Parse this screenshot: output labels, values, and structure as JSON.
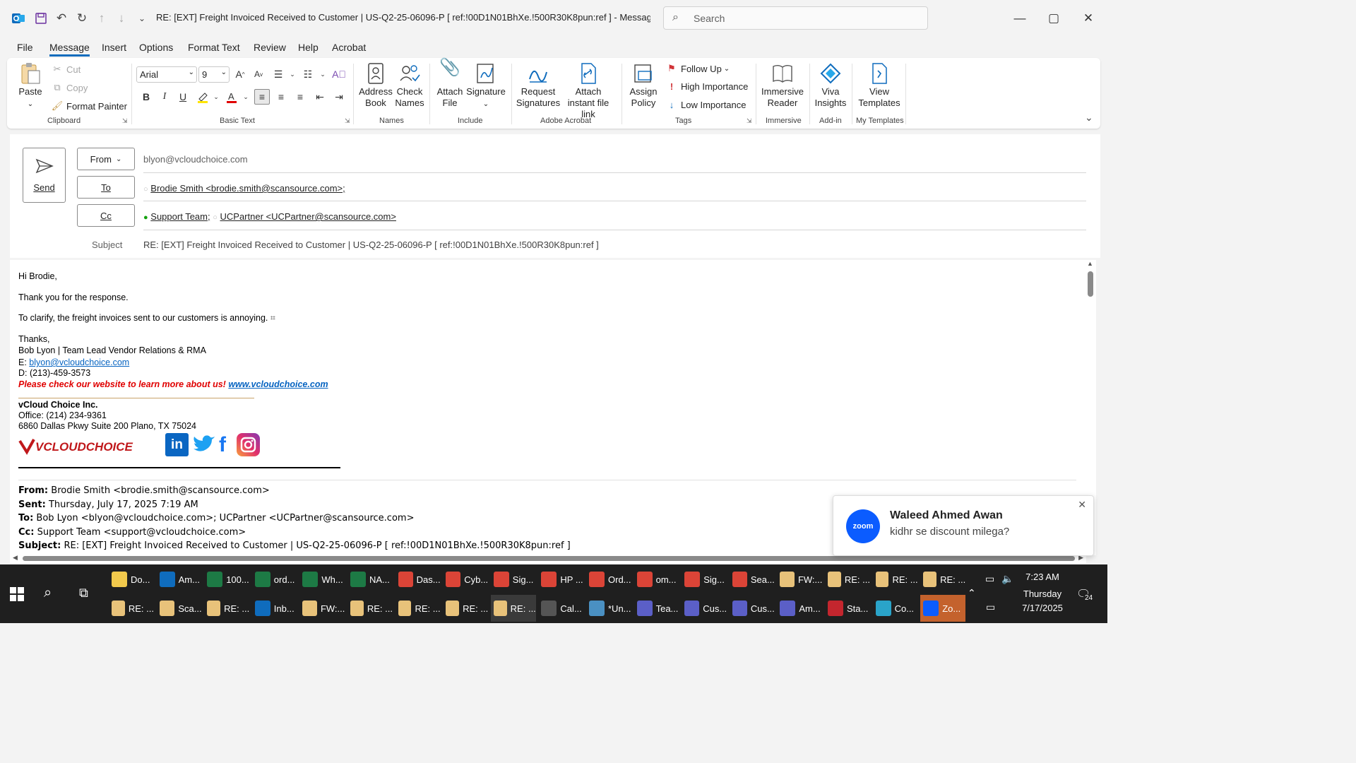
{
  "window": {
    "title": "RE: [EXT] Freight Invoiced Received to Customer | US-Q2-25-06096-P    [ ref:!00D1N01BhXe.!500R30K8pun:ref ]  - Message (HT...",
    "search_placeholder": "Search"
  },
  "menu": {
    "tabs": [
      "File",
      "Message",
      "Insert",
      "Options",
      "Format Text",
      "Review",
      "Help",
      "Acrobat"
    ],
    "active": "Message"
  },
  "ribbon": {
    "clipboard": {
      "paste": "Paste",
      "cut": "Cut",
      "copy": "Copy",
      "format_painter": "Format Painter",
      "label": "Clipboard"
    },
    "basic_text": {
      "font": "Arial",
      "size": "9",
      "label": "Basic Text"
    },
    "names": {
      "address_book": "Address Book",
      "check_names": "Check Names",
      "label": "Names"
    },
    "include": {
      "attach_file": "Attach File",
      "signature": "Signature",
      "label": "Include"
    },
    "adobe": {
      "request_signatures": "Request Signatures",
      "attach_link": "Attach instant file link",
      "label": "Adobe Acrobat"
    },
    "tags": {
      "assign_policy": "Assign Policy",
      "follow_up": "Follow Up",
      "high": "High Importance",
      "low": "Low Importance",
      "label": "Tags"
    },
    "immersive": {
      "reader": "Immersive Reader",
      "label": "Immersive"
    },
    "addin": {
      "viva": "Viva Insights",
      "label": "Add-in"
    },
    "templates": {
      "view": "View Templates",
      "label": "My Templates"
    }
  },
  "compose": {
    "send": "Send",
    "from_label": "From",
    "from_value": "blyon@vcloudchoice.com",
    "to_label": "To",
    "to_value": "Brodie Smith <brodie.smith@scansource.com>;",
    "cc_label": "Cc",
    "cc_1": "Support Team;",
    "cc_2": "UCPartner <UCPartner@scansource.com>",
    "subject_label": "Subject",
    "subject_value": "RE: [EXT] Freight Invoiced Received to Customer | US-Q2-25-06096-P    [ ref:!00D1N01BhXe.!500R30K8pun:ref ]"
  },
  "body": {
    "greeting": "Hi Brodie,",
    "line1": "Thank you for the response.",
    "line2": "To clarify, the freight invoices sent to our customers is annoying.",
    "thanks": "Thanks,",
    "sig_name": "Bob Lyon | Team Lead Vendor Relations & RMA",
    "sig_email_prefix": "E: ",
    "sig_email": "blyon@vcloudchoice.com",
    "sig_phone": "D: (213)-459-3573",
    "sig_promo": "Please check our website to learn more about us! ",
    "sig_site": "www.vcloudchoice.com",
    "company": "vCloud Choice Inc.",
    "office": "Office: (214) 234-9361",
    "address": "6860 Dallas Pkwy Suite 200 Plano, TX 75024",
    "logo_text": "VCLOUDCHOICE",
    "quote_from_label": "From:",
    "quote_from": " Brodie Smith <brodie.smith@scansource.com>",
    "quote_sent_label": "Sent:",
    "quote_sent": " Thursday, July 17, 2025 7:19 AM",
    "quote_to_label": "To:",
    "quote_to": " Bob Lyon <blyon@vcloudchoice.com>; UCPartner <UCPartner@scansource.com>",
    "quote_cc_label": "Cc:",
    "quote_cc": " Support Team <support@vcloudchoice.com>",
    "quote_subj_label": "Subject:",
    "quote_subj": " RE: [EXT] Freight Invoiced Received to Customer | US-Q2-25-06096-P [ ref:!00D1N01BhXe.!500R30K8pun:ref ]"
  },
  "toast": {
    "name": "Waleed Ahmed Awan",
    "message": "kidhr se discount milega?",
    "app": "zoom"
  },
  "taskbar": {
    "row1": [
      "Do...",
      "Am...",
      "100...",
      "ord...",
      "Wh...",
      "NA...",
      "Das...",
      "Cyb...",
      "Sig...",
      "HP ...",
      "Ord...",
      "om...",
      "Sig...",
      "Sea...",
      "FW:...",
      "RE: ...",
      "RE: ...",
      "RE: ..."
    ],
    "row2": [
      "RE: ...",
      "Sca...",
      "RE: ...",
      "Inb...",
      "FW:...",
      "RE: ...",
      "RE: ...",
      "RE: ...",
      "RE: ...",
      "Cal...",
      "*Un...",
      "Tea...",
      "Cus...",
      "Cus...",
      "Am...",
      "Sta...",
      "Co...",
      "Zo..."
    ],
    "time": "7:23 AM",
    "day": "Thursday",
    "date": "7/17/2025",
    "notif_count": "24"
  },
  "colors": {
    "accent": "#0f6cbd",
    "promo_red": "#e00000",
    "link": "#0563c1",
    "taskbar": "#1f1f1f"
  }
}
